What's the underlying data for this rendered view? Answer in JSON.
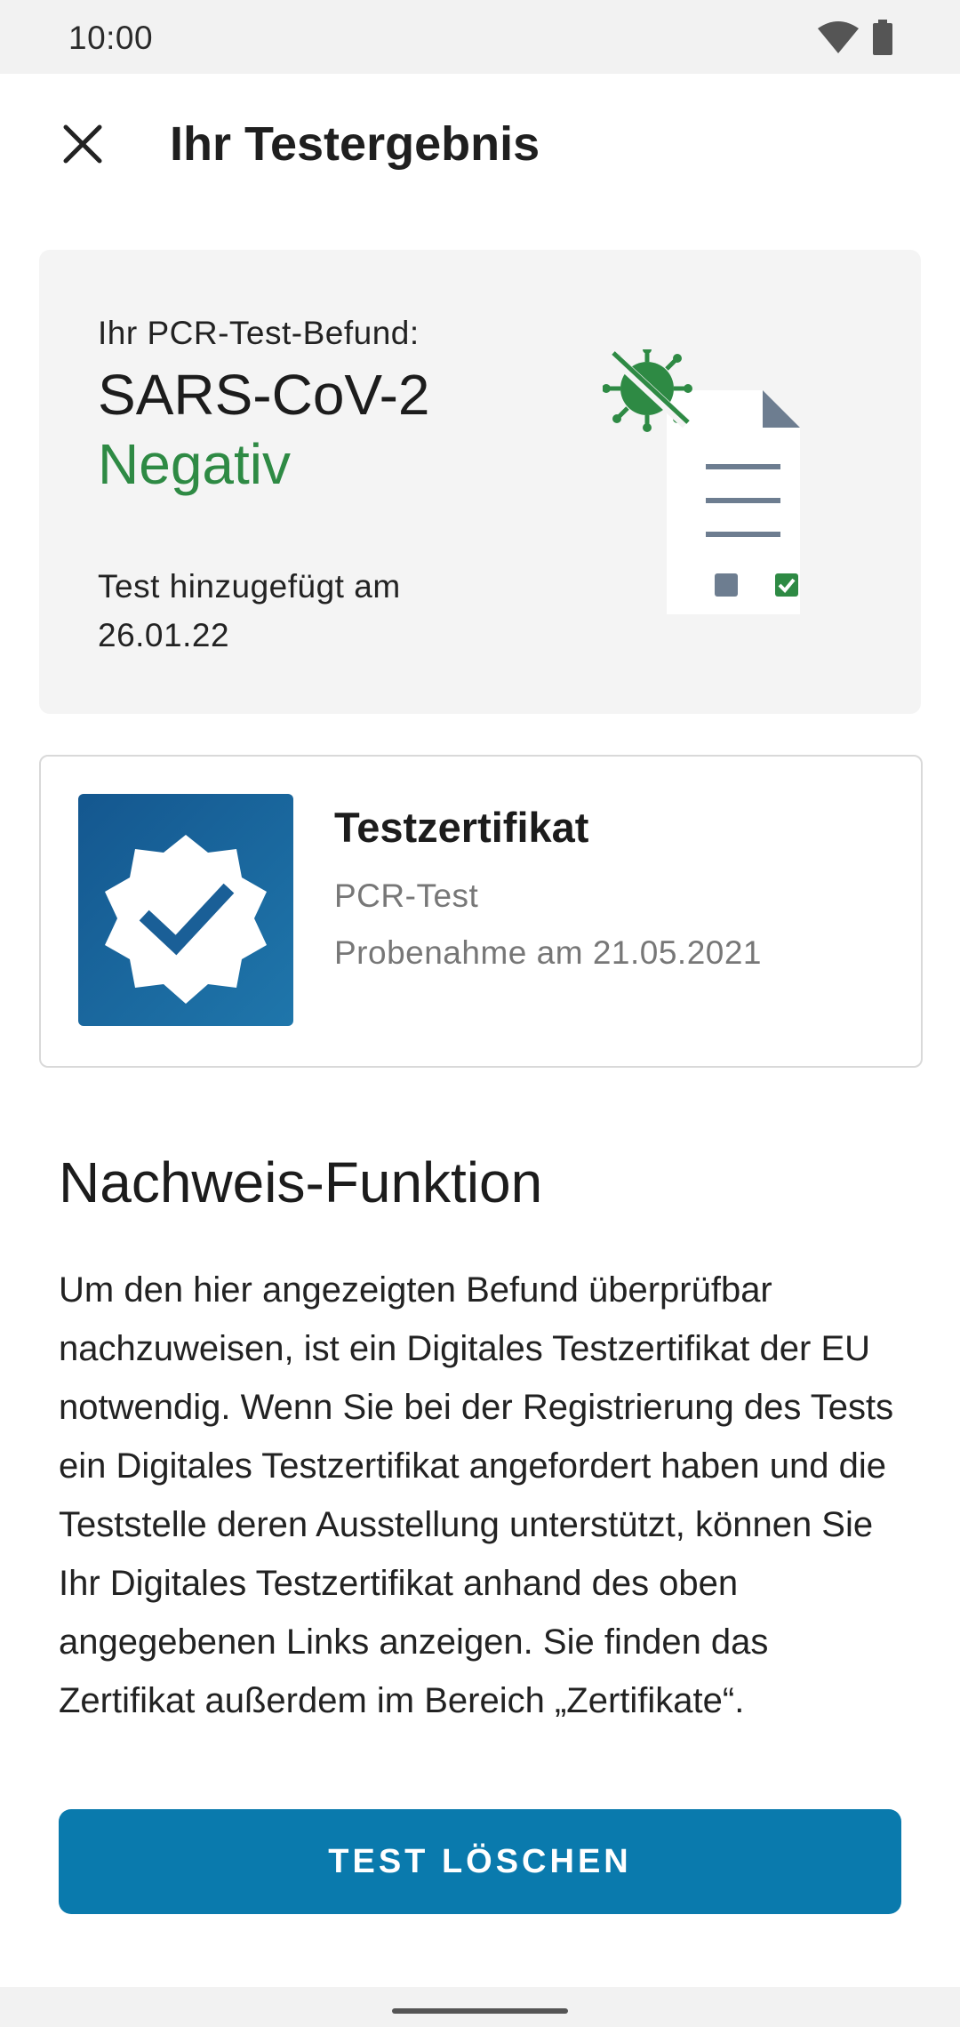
{
  "status_bar": {
    "time": "10:00"
  },
  "app_bar": {
    "title": "Ihr Testergebnis"
  },
  "result_card": {
    "label": "Ihr PCR-Test-Befund:",
    "virus": "SARS-CoV-2",
    "result": "Negativ",
    "added": "Test hinzugefügt am 26.01.22"
  },
  "certificate": {
    "title": "Testzertifikat",
    "type": "PCR-Test",
    "sample_date": "Probenahme am 21.05.2021"
  },
  "section": {
    "title": "Nachweis-Funktion",
    "body": "Um den hier angezeigten Befund überprüfbar nachzuweisen, ist ein Digitales Testzertifikat der EU notwendig. Wenn Sie bei der Registrierung des Tests ein Digitales Testzertifikat angefordert haben und die Teststelle deren Ausstellung unterstützt, können Sie Ihr Digitales Testzertifikat anhand des oben angegebenen Links anzeigen. Sie finden das Zertifikat außerdem im Bereich „Zertifikate“."
  },
  "actions": {
    "delete_label": "TEST LÖSCHEN"
  },
  "colors": {
    "accent": "#0a7aad",
    "negative": "#2e8a44",
    "cert_blue": "#14578f"
  },
  "icons": [
    "wifi-icon",
    "battery-icon",
    "close-icon",
    "virus-icon",
    "document-icon",
    "certificate-badge-icon"
  ]
}
